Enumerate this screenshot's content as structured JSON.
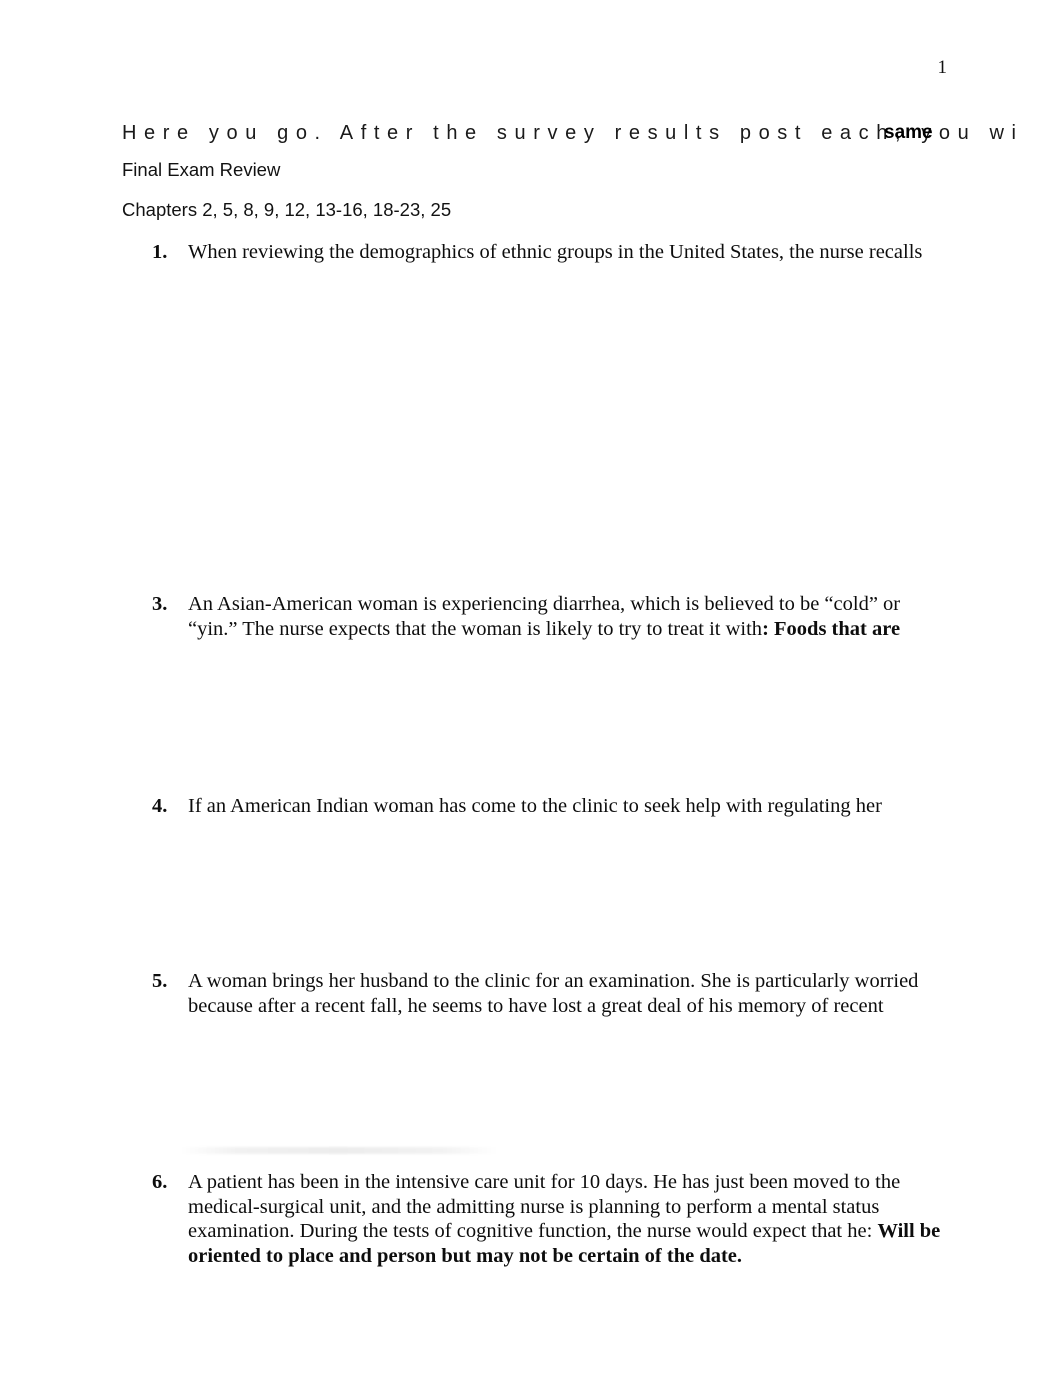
{
  "document": {
    "page_number": "1",
    "overlay_header": {
      "base_text": "Here you go. After the survey results post each, you wi",
      "overlapping_text": "same"
    },
    "headings": {
      "title": "Final Exam Review",
      "chapters": "Chapters 2, 5, 8, 9, 12, 13-16, 18-23, 25"
    },
    "questions": [
      {
        "number": "1.",
        "text": "When reviewing the demographics of ethnic groups in the United States, the nurse recalls",
        "bold_answer": ""
      },
      {
        "number": "3.",
        "text": "An Asian-American woman is experiencing diarrhea, which is believed to be “cold” or “yin.” The nurse expects that the woman is likely to try to treat it with",
        "bold_answer": ": Foods that are"
      },
      {
        "number": "4.",
        "text": "If an American Indian woman has come to the clinic to seek help with regulating her",
        "bold_answer": ""
      },
      {
        "number": "5.",
        "text": "A woman brings her husband to the clinic for an examination. She is particularly worried because after a recent fall, he seems to have lost a great deal of his memory of recent",
        "bold_answer": ""
      },
      {
        "number": "6.",
        "text": "A patient has been in the intensive care unit for 10 days. He has just been moved to the medical-surgical unit, and the admitting nurse is planning to perform a mental status examination. During the tests of cognitive function, the nurse would expect that he:  ",
        "bold_answer": "Will be oriented to place and person but may not be certain of the date."
      }
    ]
  }
}
